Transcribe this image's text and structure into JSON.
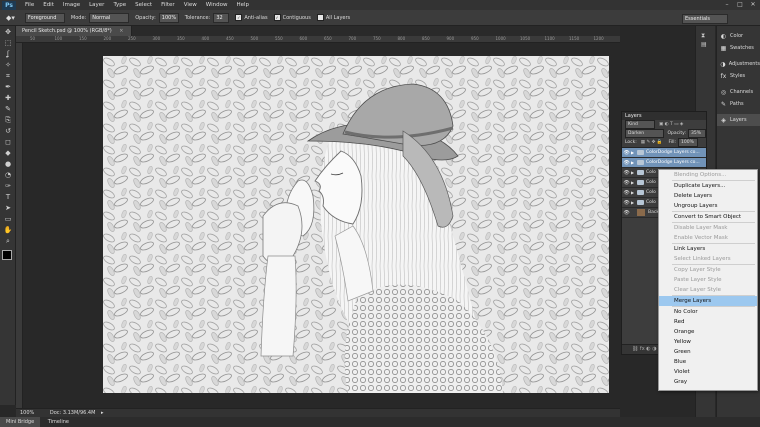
{
  "app": {
    "logo": "Ps"
  },
  "menu": [
    "File",
    "Edit",
    "Image",
    "Layer",
    "Type",
    "Select",
    "Filter",
    "View",
    "Window",
    "Help"
  ],
  "window_buttons": [
    "–",
    "□",
    "✕"
  ],
  "options": {
    "foreground_mode": "Foreground",
    "mode_label": "Mode:",
    "mode_value": "Normal",
    "opacity_label": "Opacity:",
    "opacity_value": "100%",
    "tolerance_label": "Tolerance:",
    "tolerance_value": "32",
    "antialias_label": "Anti-alias",
    "contiguous_label": "Contiguous",
    "all_layers_label": "All Layers",
    "workspace": "Essentials"
  },
  "document": {
    "tab_title": "Pencil Sketch.psd @ 100% (RGB/8*)",
    "close": "×",
    "zoom": "100%",
    "doc_size": "Doc: 3.13M/96.4M"
  },
  "ruler_ticks": [
    "50",
    "100",
    "150",
    "200",
    "250",
    "300",
    "350",
    "400",
    "450",
    "500",
    "550",
    "600",
    "650",
    "700",
    "750",
    "800",
    "850",
    "900",
    "950",
    "1000",
    "1050",
    "1100",
    "1150",
    "1200"
  ],
  "bottom_tabs": [
    "Mini Bridge",
    "Timeline"
  ],
  "dock": [
    {
      "icon": "color-icon",
      "label": "Color",
      "glyph": "◐"
    },
    {
      "icon": "swatches-icon",
      "label": "Swatches",
      "glyph": "▦"
    },
    {
      "icon": "adjustments-icon",
      "label": "Adjustments",
      "glyph": "◑"
    },
    {
      "icon": "styles-icon",
      "label": "Styles",
      "glyph": "fx"
    },
    {
      "icon": "channels-icon",
      "label": "Channels",
      "glyph": "◎"
    },
    {
      "icon": "paths-icon",
      "label": "Paths",
      "glyph": "✎"
    },
    {
      "icon": "layers-icon",
      "label": "Layers",
      "glyph": "◈"
    }
  ],
  "layers_panel": {
    "title": "Layers",
    "kind": "Kind",
    "blend_mode": "Darken",
    "opacity_label": "Opacity:",
    "opacity_value": "35%",
    "lock_label": "Lock:",
    "fill_label": "Fill:",
    "fill_value": "100%",
    "layers": [
      {
        "name": "ColorDodge Layers co...",
        "type": "group",
        "selected": true
      },
      {
        "name": "ColorDodge Layers co...",
        "type": "group",
        "selected": true
      },
      {
        "name": "Colo",
        "type": "group",
        "selected": false
      },
      {
        "name": "Colo",
        "type": "group",
        "selected": false
      },
      {
        "name": "Colo",
        "type": "group",
        "selected": false
      },
      {
        "name": "Colo",
        "type": "group",
        "selected": false
      },
      {
        "name": "Back",
        "type": "image",
        "selected": false
      }
    ]
  },
  "context_menu": [
    {
      "label": "Blending Options...",
      "disabled": true
    },
    {
      "sep": true
    },
    {
      "label": "Duplicate Layers...",
      "disabled": false
    },
    {
      "label": "Delete Layers",
      "disabled": false
    },
    {
      "label": "Ungroup Layers",
      "disabled": false
    },
    {
      "sep": true
    },
    {
      "label": "Convert to Smart Object",
      "disabled": false
    },
    {
      "sep": true
    },
    {
      "label": "Disable Layer Mask",
      "disabled": true
    },
    {
      "label": "Enable Vector Mask",
      "disabled": true
    },
    {
      "sep": true
    },
    {
      "label": "Link Layers",
      "disabled": false
    },
    {
      "label": "Select Linked Layers",
      "disabled": true
    },
    {
      "sep": true
    },
    {
      "label": "Copy Layer Style",
      "disabled": true
    },
    {
      "label": "Paste Layer Style",
      "disabled": true
    },
    {
      "label": "Clear Layer Style",
      "disabled": true
    },
    {
      "sep": true
    },
    {
      "label": "Merge Layers",
      "disabled": false,
      "highlighted": true
    },
    {
      "sep": true
    },
    {
      "label": "No Color",
      "disabled": false
    },
    {
      "label": "Red",
      "disabled": false
    },
    {
      "label": "Orange",
      "disabled": false
    },
    {
      "label": "Yellow",
      "disabled": false
    },
    {
      "label": "Green",
      "disabled": false
    },
    {
      "label": "Blue",
      "disabled": false
    },
    {
      "label": "Violet",
      "disabled": false
    },
    {
      "label": "Gray",
      "disabled": false
    }
  ],
  "tools": [
    "move-tool-icon",
    "marquee-tool-icon",
    "lasso-tool-icon",
    "quick-select-tool-icon",
    "crop-tool-icon",
    "eyedropper-tool-icon",
    "healing-tool-icon",
    "brush-tool-icon",
    "stamp-tool-icon",
    "history-brush-tool-icon",
    "eraser-tool-icon",
    "bucket-tool-icon",
    "blur-tool-icon",
    "dodge-tool-icon",
    "pen-tool-icon",
    "type-tool-icon",
    "path-select-tool-icon",
    "shape-tool-icon",
    "hand-tool-icon",
    "zoom-tool-icon"
  ],
  "tool_glyphs": [
    "✥",
    "⬚",
    "ʆ",
    "✧",
    "⌗",
    "✒",
    "✚",
    "✎",
    "⎘",
    "↺",
    "◻",
    "◆",
    "●",
    "◔",
    "✑",
    "T",
    "➤",
    "▭",
    "✋",
    "⌕"
  ]
}
